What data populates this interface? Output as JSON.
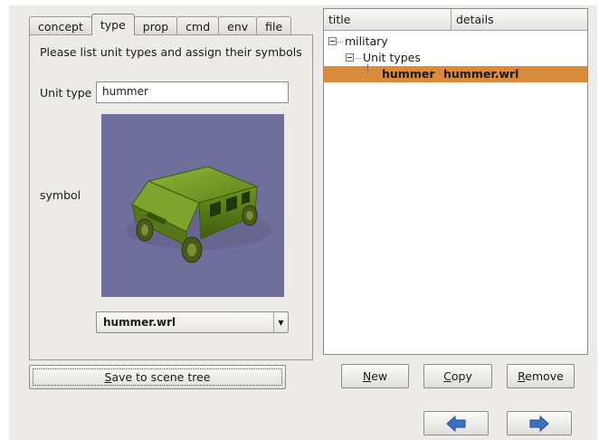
{
  "tabs": [
    {
      "label": "concept",
      "active": false
    },
    {
      "label": "type",
      "active": true
    },
    {
      "label": "prop",
      "active": false
    },
    {
      "label": "cmd",
      "active": false
    },
    {
      "label": "env",
      "active": false
    },
    {
      "label": "file",
      "active": false
    }
  ],
  "form": {
    "instructions": "Please list unit types and assign their symbols",
    "unit_type_label": "Unit type",
    "unit_type_value": "hummer",
    "symbol_label": "symbol",
    "symbol_file": "hummer.wrl",
    "symbol_image": "hummer-3d-model",
    "save_button": {
      "pre": "",
      "key": "S",
      "post": "ave to scene tree"
    }
  },
  "tree": {
    "columns": [
      "title",
      "details"
    ],
    "nodes": [
      {
        "title": "military",
        "details": ""
      },
      {
        "title": "Unit types",
        "details": ""
      },
      {
        "title": "hummer",
        "details": "hummer.wrl",
        "selected": true
      }
    ]
  },
  "buttons": {
    "new": {
      "key": "N",
      "rest": "ew"
    },
    "copy": {
      "key": "C",
      "rest": "opy"
    },
    "remove": {
      "key": "R",
      "rest": "emove"
    }
  },
  "nav": {
    "back_icon": "arrow-left-icon",
    "forward_icon": "arrow-right-icon"
  },
  "colors": {
    "selection": "#d98a3a",
    "viewport_bg": "#706f9c",
    "arrow_blue": "#3b72c6",
    "vehicle_green": "#6b8f1f"
  }
}
